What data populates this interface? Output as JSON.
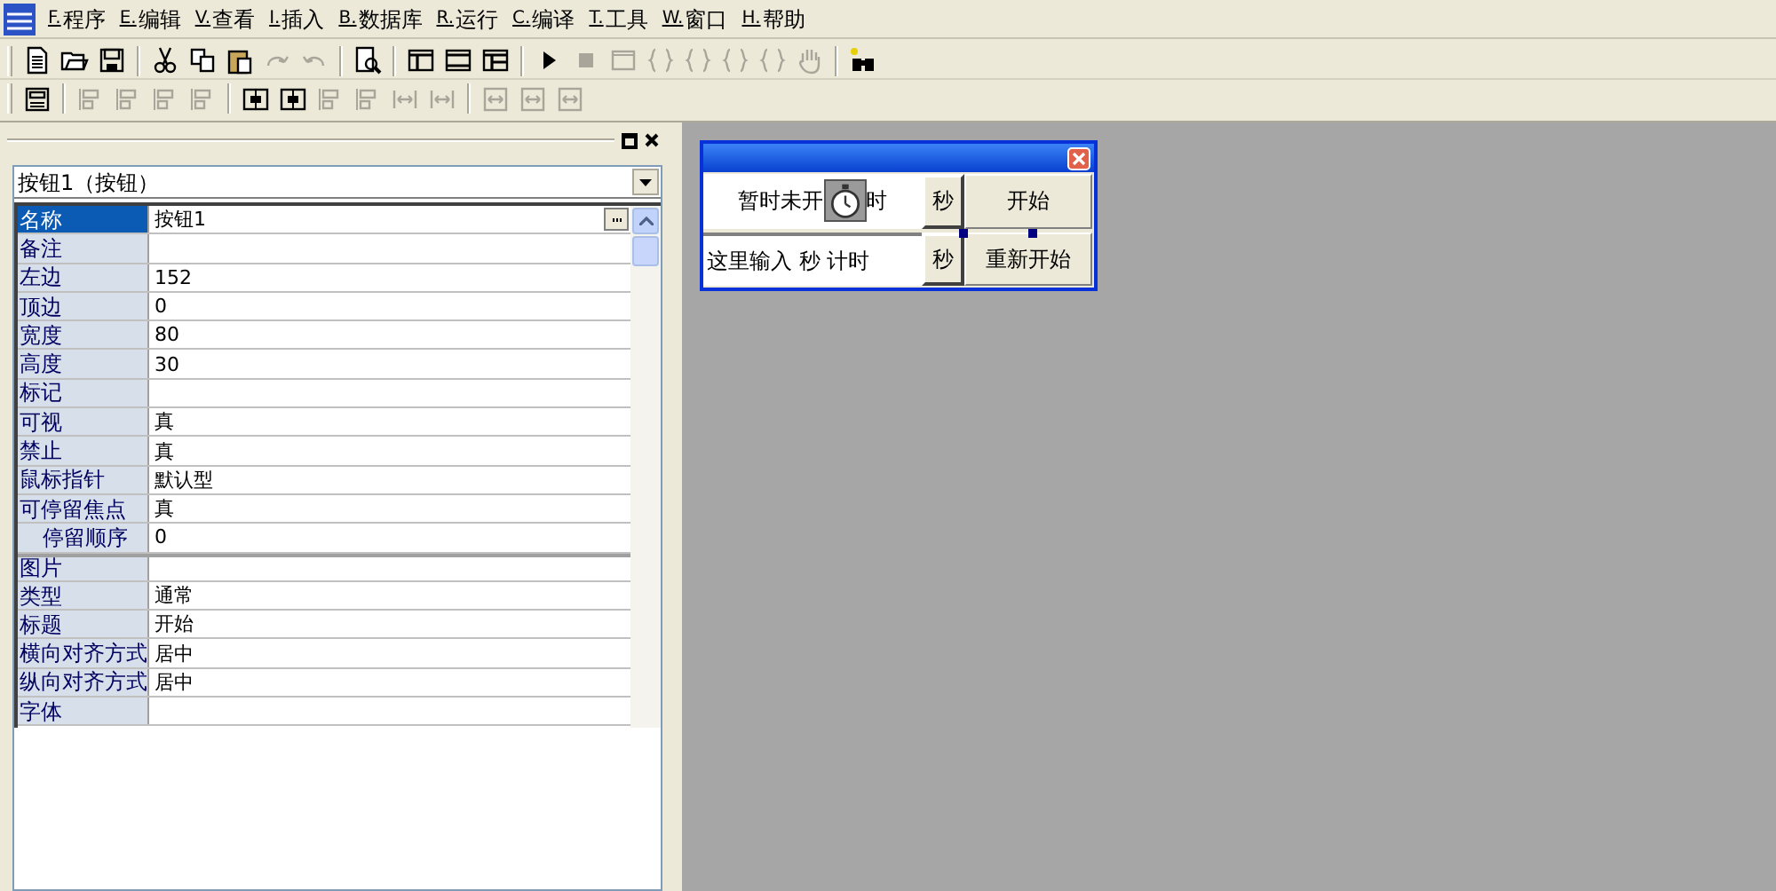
{
  "menu": [
    {
      "key": "F.",
      "label": "程序"
    },
    {
      "key": "E.",
      "label": "编辑"
    },
    {
      "key": "V.",
      "label": "查看"
    },
    {
      "key": "I.",
      "label": "插入"
    },
    {
      "key": "B.",
      "label": "数据库"
    },
    {
      "key": "R.",
      "label": "运行"
    },
    {
      "key": "C.",
      "label": "编译"
    },
    {
      "key": "T.",
      "label": "工具"
    },
    {
      "key": "W.",
      "label": "窗口"
    },
    {
      "key": "H.",
      "label": "帮助"
    }
  ],
  "toolbars": [
    [
      {
        "kind": "document",
        "disabled": false
      },
      {
        "kind": "folder",
        "disabled": false
      },
      {
        "kind": "save",
        "disabled": false
      },
      {
        "kind": "separator"
      },
      {
        "kind": "scissors",
        "disabled": false
      },
      {
        "kind": "copy",
        "disabled": false
      },
      {
        "kind": "clipboard",
        "disabled": false
      },
      {
        "kind": "redo",
        "disabled": true
      },
      {
        "kind": "undo",
        "disabled": true
      },
      {
        "kind": "separator"
      },
      {
        "kind": "magnifier",
        "disabled": false
      },
      {
        "kind": "separator"
      },
      {
        "kind": "layout-left",
        "disabled": false
      },
      {
        "kind": "layout-rows",
        "disabled": false
      },
      {
        "kind": "layout-grid",
        "disabled": false
      },
      {
        "kind": "separator"
      },
      {
        "kind": "play",
        "disabled": false
      },
      {
        "kind": "stop",
        "disabled": true
      },
      {
        "kind": "window",
        "disabled": true
      },
      {
        "kind": "brace",
        "disabled": true
      },
      {
        "kind": "brace",
        "disabled": true
      },
      {
        "kind": "brace",
        "disabled": true
      },
      {
        "kind": "brace",
        "disabled": true
      },
      {
        "kind": "hand",
        "disabled": true
      },
      {
        "kind": "separator"
      },
      {
        "kind": "binoculars",
        "disabled": false
      }
    ],
    [
      {
        "kind": "form",
        "disabled": false
      },
      {
        "kind": "separator"
      },
      {
        "kind": "align",
        "disabled": true
      },
      {
        "kind": "align",
        "disabled": true
      },
      {
        "kind": "align",
        "disabled": true
      },
      {
        "kind": "align",
        "disabled": true
      },
      {
        "kind": "separator"
      },
      {
        "kind": "center",
        "disabled": false
      },
      {
        "kind": "center",
        "disabled": false
      },
      {
        "kind": "align",
        "disabled": true
      },
      {
        "kind": "align",
        "disabled": true
      },
      {
        "kind": "spacing",
        "disabled": true
      },
      {
        "kind": "spacing",
        "disabled": true
      },
      {
        "kind": "separator"
      },
      {
        "kind": "size",
        "disabled": true
      },
      {
        "kind": "size",
        "disabled": true
      },
      {
        "kind": "size",
        "disabled": true
      }
    ]
  ],
  "properties": {
    "object": "按钮1（按钮）",
    "rows": [
      {
        "name": "名称",
        "value": "按钮1",
        "selected": true
      },
      {
        "name": "备注",
        "value": "",
        "selected": false
      },
      {
        "name": "左边",
        "value": "152",
        "selected": false
      },
      {
        "name": "顶边",
        "value": "0",
        "selected": false
      },
      {
        "name": "宽度",
        "value": "80",
        "selected": false
      },
      {
        "name": "高度",
        "value": "30",
        "selected": false
      },
      {
        "name": "标记",
        "value": "",
        "selected": false
      },
      {
        "name": "可视",
        "value": "真",
        "selected": false
      },
      {
        "name": "禁止",
        "value": "真",
        "selected": false
      },
      {
        "name": "鼠标指针",
        "value": "默认型",
        "selected": false
      },
      {
        "name": "可停留焦点",
        "value": "真",
        "selected": false,
        "children": [
          {
            "name": "停留顺序",
            "value": "0",
            "selected": false
          }
        ]
      },
      {
        "name": "图片",
        "value": "",
        "selected": false
      },
      {
        "name": "类型",
        "value": "通常",
        "selected": false
      },
      {
        "name": "标题",
        "value": "开始",
        "selected": false
      },
      {
        "name": "横向对齐方式",
        "value": "居中",
        "selected": false
      },
      {
        "name": "纵向对齐方式",
        "value": "居中",
        "selected": false
      },
      {
        "name": "字体",
        "value": "",
        "selected": false
      }
    ]
  },
  "form": {
    "label_left": "暂时未开",
    "label_right": "时",
    "unit_top": "秒",
    "start_button": "开始",
    "input_value": "这里输入 秒 计时",
    "unit_bottom": "秒",
    "restart_button": "重新开始"
  }
}
